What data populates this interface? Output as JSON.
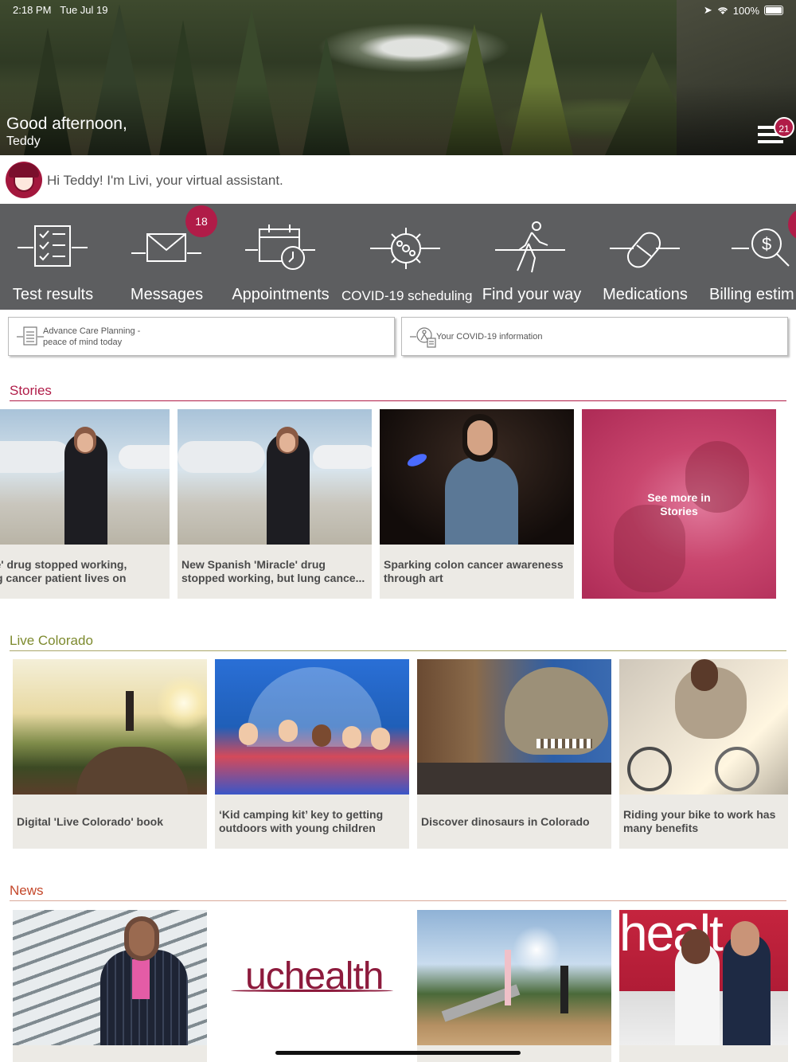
{
  "status_bar": {
    "time": "2:18 PM",
    "date": "Tue Jul 19",
    "battery": "100%"
  },
  "header": {
    "greeting": "Good afternoon,",
    "name": "Teddy",
    "menu_badge": "21"
  },
  "assistant": {
    "message": "Hi Teddy! I'm Livi, your virtual assistant."
  },
  "quick_actions": [
    {
      "label": "Test results",
      "icon": "checklist-icon"
    },
    {
      "label": "Messages",
      "icon": "envelope-icon",
      "badge": "18"
    },
    {
      "label": "Appointments",
      "icon": "calendar-clock-icon"
    },
    {
      "label": "COVID-19 scheduling",
      "icon": "virus-icon"
    },
    {
      "label": "Find your way",
      "icon": "walking-person-icon"
    },
    {
      "label": "Medications",
      "icon": "pill-icon"
    },
    {
      "label": "Billing estim",
      "icon": "dollar-search-icon"
    }
  ],
  "info_buttons": [
    {
      "line1": "Advance Care Planning -",
      "line2": "peace of mind today",
      "icon": "document-list-icon"
    },
    {
      "line1": "Your COVID-19 information",
      "icon": "person-document-icon"
    }
  ],
  "sections": {
    "stories": {
      "title": "Stories",
      "color": "#b01c48",
      "cards": [
        {
          "caption1": "acle' drug stopped working,",
          "caption2": "lung cancer patient lives on"
        },
        {
          "caption1": "New Spanish 'Miracle' drug",
          "caption2": "stopped working, but lung cance..."
        },
        {
          "caption1": "Sparking colon cancer awareness",
          "caption2": "through art"
        }
      ],
      "see_more1": "See more in",
      "see_more2": "Stories"
    },
    "live_colorado": {
      "title": "Live Colorado",
      "color": "#7d8a2e",
      "cards": [
        {
          "caption1": "Digital 'Live Colorado' book"
        },
        {
          "caption1": "‘Kid camping kit’ key to getting",
          "caption2": "outdoors with young children"
        },
        {
          "caption1": "Discover dinosaurs in Colorado"
        },
        {
          "caption1": "Riding your bike to work has",
          "caption2": "many benefits"
        }
      ]
    },
    "news": {
      "title": "News",
      "color": "#c4472a",
      "logo_text": "uchealth",
      "banner_text": "healt"
    }
  }
}
